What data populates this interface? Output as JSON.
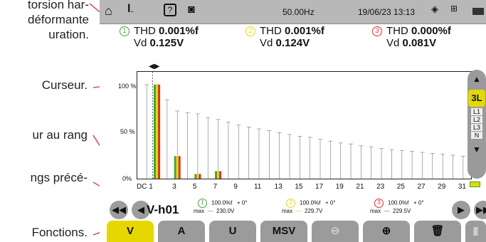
{
  "annotations": {
    "distortion_line1": "torsion har-",
    "distortion_line2": "déformante",
    "distortion_line3": "uration.",
    "cursor": "Curseur.",
    "rank": "ur au rang",
    "previous": "ngs précé-",
    "functions": "Fonctions."
  },
  "status": {
    "frequency": "50.00Hz",
    "datetime": "19/06/23 13:13"
  },
  "measures": [
    {
      "channel": "1",
      "thd_label": "THD",
      "thd": "0.001%f",
      "vd_label": "Vd",
      "vd": "0.125V",
      "color": "#39a935"
    },
    {
      "channel": "2",
      "thd_label": "THD",
      "thd": "0.001%f",
      "vd_label": "Vd",
      "vd": "0.124V",
      "color": "#e5d800"
    },
    {
      "channel": "3",
      "thd_label": "THD",
      "thd": "0.000%f",
      "vd_label": "Vd",
      "vd": "0.081V",
      "color": "#e42b2b"
    }
  ],
  "chart_data": {
    "type": "bar",
    "categories": [
      "DC",
      "1",
      "2",
      "3",
      "4",
      "5",
      "6",
      "7",
      "8",
      "9",
      "10",
      "11",
      "12",
      "13",
      "14",
      "15",
      "16",
      "17",
      "18",
      "19",
      "20",
      "21",
      "22",
      "23",
      "24",
      "25",
      "26",
      "27",
      "28",
      "29",
      "30",
      "31"
    ],
    "series": [
      {
        "name": "1",
        "values": [
          0,
          100,
          0,
          24,
          0,
          5,
          0,
          8,
          0,
          0,
          0,
          0,
          0,
          0,
          0,
          0,
          0,
          0,
          0,
          0,
          0,
          0,
          0,
          0,
          0,
          0,
          0,
          0,
          0,
          0,
          0,
          0
        ]
      },
      {
        "name": "2",
        "values": [
          0,
          100,
          0,
          24,
          0,
          5,
          0,
          8,
          0,
          0,
          0,
          0,
          0,
          0,
          0,
          0,
          0,
          0,
          0,
          0,
          0,
          0,
          0,
          0,
          0,
          0,
          0,
          0,
          0,
          0,
          0,
          0
        ]
      },
      {
        "name": "3",
        "values": [
          0,
          100,
          0,
          24,
          0,
          5,
          0,
          8,
          0,
          0,
          0,
          0,
          0,
          0,
          0,
          0,
          0,
          0,
          0,
          0,
          0,
          0,
          0,
          0,
          0,
          0,
          0,
          0,
          0,
          0,
          0,
          0
        ]
      }
    ],
    "max_whiskers": [
      100,
      100,
      84,
      72,
      70,
      69,
      65,
      63,
      60,
      57,
      55,
      53,
      51,
      49,
      47,
      45,
      44,
      42,
      40,
      38,
      37,
      35,
      34,
      32,
      31,
      30,
      29,
      28,
      27,
      26,
      25,
      24
    ],
    "ylim": [
      0,
      100
    ],
    "yticks": [
      "100 %",
      "50 %",
      "0%"
    ],
    "xticks": [
      "DC 1",
      "3",
      "5",
      "7",
      "9",
      "11",
      "13",
      "15",
      "17",
      "19",
      "21",
      "23",
      "25",
      "27",
      "29",
      "31"
    ]
  },
  "selection": {
    "label": "V-h01"
  },
  "readouts": [
    {
      "channel": "1",
      "percent": "100.0%f",
      "phase": "+ 0°",
      "max_label": "max",
      "dash": "—",
      "max": "230.0V",
      "color": "#39a935"
    },
    {
      "channel": "2",
      "percent": "100.0%f",
      "phase": "+ 0°",
      "max_label": "max",
      "dash": "—",
      "max": "229.7V",
      "color": "#e5d800"
    },
    {
      "channel": "3",
      "percent": "100.0%f",
      "phase": "+ 0°",
      "max_label": "max",
      "dash": "—",
      "max": "229.5V",
      "color": "#e42b2b"
    }
  ],
  "side": {
    "mode": "3L",
    "l1": "L1",
    "l2": "L2",
    "l3": "L3",
    "n": "N"
  },
  "tabs": [
    "V",
    "A",
    "U",
    "MSV"
  ]
}
